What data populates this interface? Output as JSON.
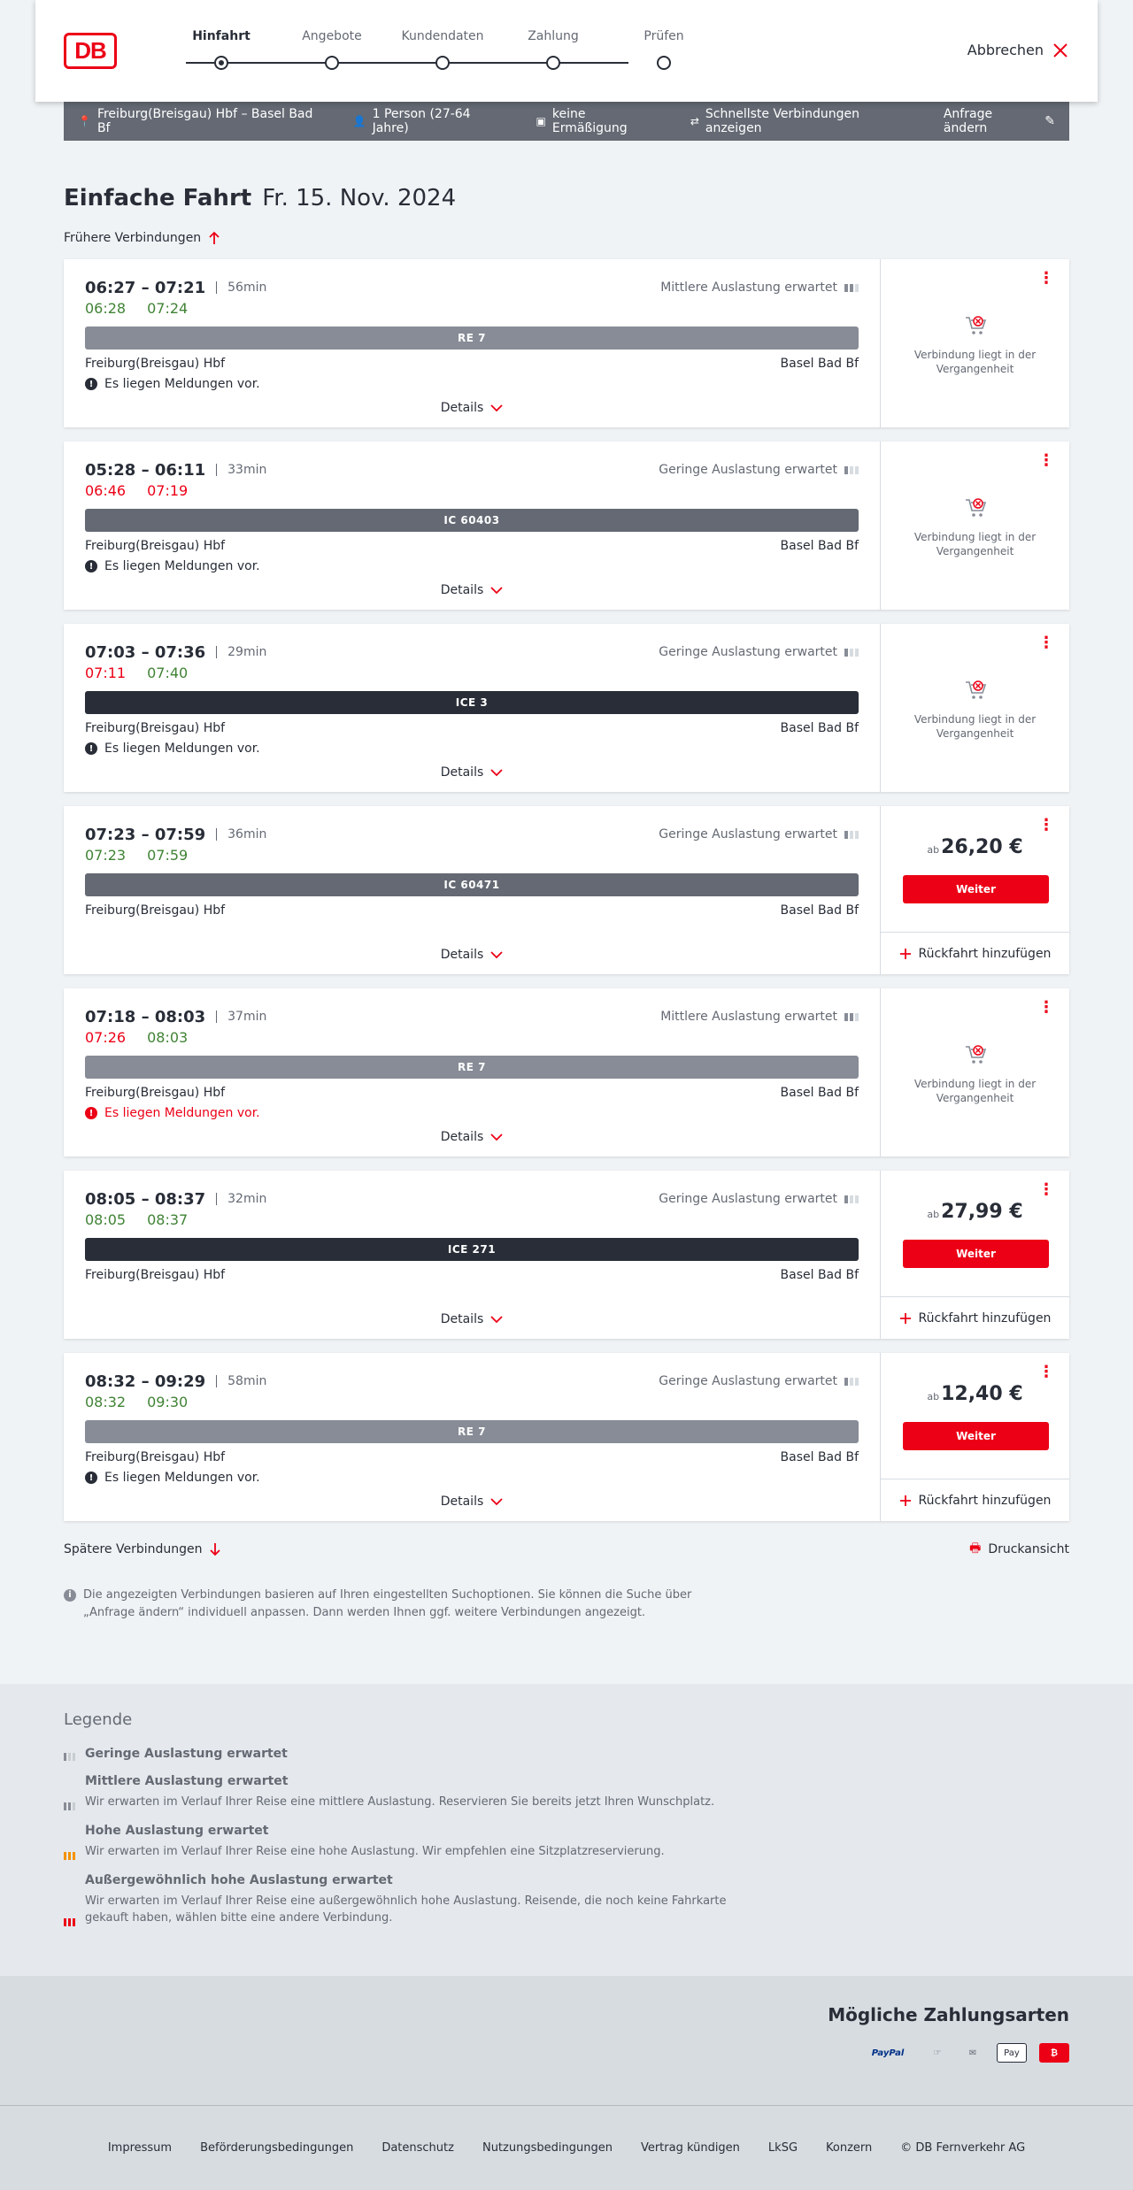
{
  "header": {
    "logo": "DB",
    "steps": [
      "Hinfahrt",
      "Angebote",
      "Kundendaten",
      "Zahlung",
      "Prüfen"
    ],
    "cancel": "Abbrechen"
  },
  "summary": {
    "route": "Freiburg(Breisgau) Hbf – Basel Bad Bf",
    "persons": "1 Person (27-64 Jahre)",
    "discount": "keine Ermäßigung",
    "fastest": "Schnellste Verbindungen anzeigen",
    "edit": "Anfrage ändern"
  },
  "page": {
    "title": "Einfache Fahrt",
    "date": "Fr. 15. Nov. 2024",
    "earlier": "Frühere Verbindungen",
    "later": "Spätere Verbindungen",
    "print": "Druckansicht"
  },
  "connections": [
    {
      "times": "06:27 – 07:21",
      "dur": "56min",
      "load": "Mittlere Auslastung erwartet",
      "rt1": "06:28",
      "rt2": "07:24",
      "rt1c": "ok",
      "rt2c": "ok",
      "train": "RE 7",
      "tbc": "re",
      "from": "Freiburg(Breisgau) Hbf",
      "to": "Basel Bad Bf",
      "msg": "Es liegen Meldungen vor.",
      "msgc": "",
      "details": "Details",
      "status": "Verbindung liegt in der Vergangenheit"
    },
    {
      "times": "05:28 – 06:11",
      "dur": "33min",
      "load": "Geringe Auslastung erwartet",
      "rt1": "06:46",
      "rt2": "07:19",
      "rt1c": "late",
      "rt2c": "late",
      "train": "IC 60403",
      "tbc": "ic",
      "from": "Freiburg(Breisgau) Hbf",
      "to": "Basel Bad Bf",
      "msg": "Es liegen Meldungen vor.",
      "msgc": "",
      "details": "Details",
      "status": "Verbindung liegt in der Vergangenheit"
    },
    {
      "times": "07:03 – 07:36",
      "dur": "29min",
      "load": "Geringe Auslastung erwartet",
      "rt1": "07:11",
      "rt2": "07:40",
      "rt1c": "late",
      "rt2c": "ok",
      "train": "ICE 3",
      "tbc": "ice",
      "from": "Freiburg(Breisgau) Hbf",
      "to": "Basel Bad Bf",
      "msg": "Es liegen Meldungen vor.",
      "msgc": "",
      "details": "Details",
      "status": "Verbindung liegt in der Vergangenheit"
    },
    {
      "times": "07:23 – 07:59",
      "dur": "36min",
      "load": "Geringe Auslastung erwartet",
      "rt1": "07:23",
      "rt2": "07:59",
      "rt1c": "ok",
      "rt2c": "ok",
      "train": "IC 60471",
      "tbc": "ic",
      "from": "Freiburg(Breisgau) Hbf",
      "to": "Basel Bad Bf",
      "msg": "",
      "msgc": "",
      "details": "Details",
      "price_prefix": "ab",
      "price": "26,20 €",
      "button": "Weiter",
      "return": "Rückfahrt hinzufügen"
    },
    {
      "times": "07:18 – 08:03",
      "dur": "37min",
      "load": "Mittlere Auslastung erwartet",
      "rt1": "07:26",
      "rt2": "08:03",
      "rt1c": "late",
      "rt2c": "ok",
      "train": "RE 7",
      "tbc": "re",
      "from": "Freiburg(Breisgau) Hbf",
      "to": "Basel Bad Bf",
      "msg": "Es liegen Meldungen vor.",
      "msgc": "red",
      "details": "Details",
      "status": "Verbindung liegt in der Vergangenheit"
    },
    {
      "times": "08:05 – 08:37",
      "dur": "32min",
      "load": "Geringe Auslastung erwartet",
      "rt1": "08:05",
      "rt2": "08:37",
      "rt1c": "ok",
      "rt2c": "ok",
      "train": "ICE 271",
      "tbc": "ice",
      "from": "Freiburg(Breisgau) Hbf",
      "to": "Basel Bad Bf",
      "msg": "",
      "msgc": "",
      "details": "Details",
      "price_prefix": "ab",
      "price": "27,99 €",
      "button": "Weiter",
      "return": "Rückfahrt hinzufügen"
    },
    {
      "times": "08:32 – 09:29",
      "dur": "58min",
      "load": "Geringe Auslastung erwartet",
      "rt1": "08:32",
      "rt2": "09:30",
      "rt1c": "ok",
      "rt2c": "ok",
      "train": "RE 7",
      "tbc": "re",
      "from": "Freiburg(Breisgau) Hbf",
      "to": "Basel Bad Bf",
      "msg": "Es liegen Meldungen vor.",
      "msgc": "",
      "details": "Details",
      "price_prefix": "ab",
      "price": "12,40 €",
      "button": "Weiter",
      "return": "Rückfahrt hinzufügen"
    }
  ],
  "info": "Die angezeigten Verbindungen basieren auf Ihren eingestellten Suchoptionen. Sie können die Suche über „Anfrage ändern“ individuell anpassen. Dann werden Ihnen ggf. weitere Verbindungen angezeigt.",
  "legend": {
    "title": "Legende",
    "items": [
      {
        "label": "Geringe Auslastung erwartet",
        "text": ""
      },
      {
        "label": "Mittlere Auslastung erwartet",
        "text": "Wir erwarten im Verlauf Ihrer Reise eine mittlere Auslastung. Reservieren Sie bereits jetzt Ihren Wunschplatz."
      },
      {
        "label": "Hohe Auslastung erwartet",
        "text": "Wir erwarten im Verlauf Ihrer Reise eine hohe Auslastung. Wir empfehlen eine Sitzplatzreservierung."
      },
      {
        "label": "Außergewöhnlich hohe Auslastung erwartet",
        "text": "Wir erwarten im Verlauf Ihrer Reise eine außergewöhnlich hohe Auslastung. Reisende, die noch keine Fahrkarte gekauft haben, wählen bitte eine andere Verbindung."
      }
    ]
  },
  "payment": {
    "title": "Mögliche Zahlungsarten",
    "paypal": "PayPal",
    "applepay": "Pay"
  },
  "footer": [
    "Impressum",
    "Beförderungsbedingungen",
    "Datenschutz",
    "Nutzungsbedingungen",
    "Vertrag kündigen",
    "LkSG",
    "Konzern",
    "© DB Fernverkehr AG"
  ],
  "colors": {
    "brand": "#ec0016",
    "ontime": "#408335",
    "delayed": "#ec0016"
  }
}
